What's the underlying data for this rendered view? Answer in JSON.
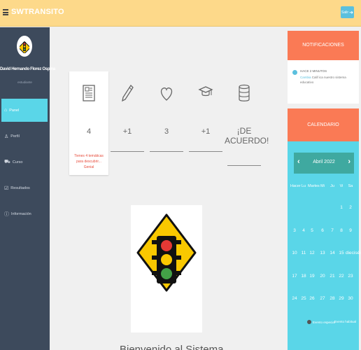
{
  "topbar": {
    "brand": "SWTRANSITO",
    "exit_label": "Salir"
  },
  "sidebar": {
    "user_name": "David Hernando Florez Ospina",
    "user_role": "estudiante",
    "items": [
      {
        "label": "Panel",
        "icon": "home-icon",
        "active": true
      },
      {
        "label": "Perfil",
        "icon": "person-icon",
        "active": false
      },
      {
        "label": "Curso",
        "icon": "car-icon",
        "active": false
      },
      {
        "label": "Resultados",
        "icon": "checklist-icon",
        "active": false
      },
      {
        "label": "Información",
        "icon": "info-icon",
        "active": false
      }
    ]
  },
  "stats": [
    {
      "icon": "newspaper-icon",
      "value": "4",
      "note": "Tienes 4 temáticas para descubrir... Genial"
    },
    {
      "icon": "pencil-icon",
      "value": "+1",
      "note": ""
    },
    {
      "icon": "heart-icon",
      "value": "3",
      "note": ""
    },
    {
      "icon": "graduation-cap-icon",
      "value": "+1",
      "note": ""
    },
    {
      "icon": "database-icon",
      "value": "¡DE ACUERDO!",
      "note": ""
    }
  ],
  "welcome": "Bienvenido al Sistema",
  "notifications": {
    "title": "NOTIFICACIONES",
    "item_title": "HACE 2 MINUTOS",
    "item_highlight": "Cambia",
    "item_text": "Calif ica nuestro sistema educativo"
  },
  "calendar": {
    "title": "CALENDARIO",
    "month": "Abril 2022",
    "weekdays": [
      "Hacer",
      "Lu",
      "Martes",
      "Mi",
      "Ju",
      "Vi",
      "Sa"
    ],
    "weeks": [
      [
        "",
        "",
        "",
        "",
        "",
        "1",
        "2"
      ],
      [
        "3",
        "4",
        "5",
        "6",
        "7",
        "8",
        "9"
      ],
      [
        "10",
        "11",
        "12",
        "13",
        "14",
        "15",
        "dieciséis"
      ],
      [
        "17",
        "18",
        "19",
        "20",
        "21",
        "22",
        "23"
      ],
      [
        "24",
        "25",
        "26",
        "27",
        "28",
        "29",
        "30"
      ]
    ],
    "legend_special": "Evento especial",
    "legend_normal": "Evento habitual"
  },
  "colors": {
    "topbar": "#fdd98a",
    "sidebar": "#3d4a5c",
    "active": "#5ad6e8",
    "panel_head": "#fa7a55",
    "calendar_nav": "#3fa9a0"
  }
}
